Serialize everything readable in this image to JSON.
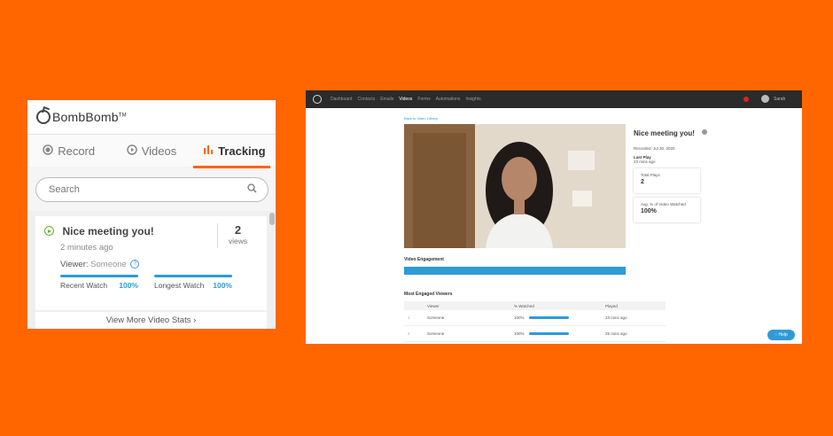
{
  "popup": {
    "brand": "BombBomb",
    "brand_tm": "TM",
    "tabs": [
      {
        "label": "Record",
        "icon": "record-icon"
      },
      {
        "label": "Videos",
        "icon": "play-icon"
      },
      {
        "label": "Tracking",
        "icon": "bar-chart-icon"
      }
    ],
    "search": {
      "placeholder": "Search"
    },
    "video": {
      "title": "Nice meeting you!",
      "time_ago": "2 minutes ago",
      "views_count": "2",
      "views_label": "views",
      "viewer_label": "Viewer:",
      "viewer_name": "Someone",
      "recent_watch_label": "Recent Watch",
      "recent_watch_value": "100%",
      "recent_watch_fraction": 1.0,
      "longest_watch_label": "Longest Watch",
      "longest_watch_value": "100%",
      "longest_watch_fraction": 1.0
    },
    "more_stats_label": "View More Video Stats ›"
  },
  "dashboard": {
    "nav": [
      "Dashboard",
      "Contacts",
      "Emails",
      "Videos",
      "Forms",
      "Automations",
      "Insights"
    ],
    "active_nav": "Videos",
    "user_label": "Sarah",
    "back_link": "Back to Video Library",
    "video_title": "Nice meeting you!",
    "recorded": "Recorded: Jul 30, 2020",
    "last_play_label": "Last Play",
    "last_play_value": "23 mins ago",
    "total_plays_label": "Total Plays",
    "total_plays_value": "2",
    "avg_watched_label": "Avg. % of Video Watched",
    "avg_watched_value": "100%",
    "engagement_label": "Video Engagement",
    "engagement_fraction": 1.0,
    "viewers_title": "Most Engaged Viewers",
    "table_headers": [
      "",
      "Viewer",
      "% Watched",
      "Played"
    ],
    "rows": [
      {
        "index": "1",
        "viewer": "Someone",
        "watched": "100%",
        "played": "23 mins ago"
      },
      {
        "index": "2",
        "viewer": "Someone",
        "watched": "100%",
        "played": "25 mins ago"
      }
    ],
    "help_label": "Help"
  },
  "colors": {
    "background": "#ff6600",
    "accent_blue": "#2e9bd6",
    "play_green": "#6cae2a",
    "notification_red": "#e02020"
  }
}
